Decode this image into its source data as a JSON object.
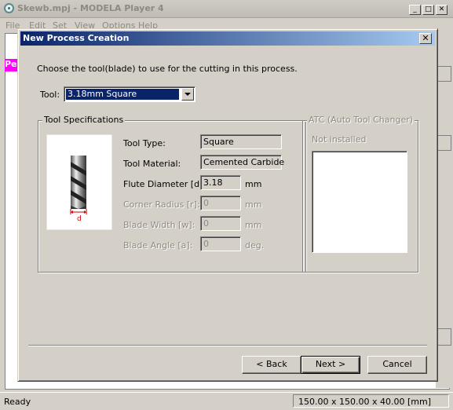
{
  "main_window": {
    "title": "Skewb.mpj - MODELA Player 4",
    "menu": [
      "File",
      "Edit",
      "Set",
      "View",
      "Options",
      "Help"
    ],
    "pink_label": "Pe",
    "status": "Ready",
    "dimensions": "150.00 x 150.00 x 40.00 [mm]"
  },
  "dialog": {
    "title": "New Process Creation",
    "instruction": "Choose the tool(blade) to use for the cutting in this process.",
    "tool_label": "Tool:",
    "tool_selected": "3.18mm Square",
    "specs": {
      "group_title": "Tool Specifications",
      "diagram_label": "d",
      "tool_type_label": "Tool Type:",
      "tool_type": "Square",
      "tool_material_label": "Tool Material:",
      "tool_material": "Cemented Carbide",
      "flute_diameter_label": "Flute Diameter [d]:",
      "flute_diameter": "3.18",
      "corner_radius_label": "Corner Radius [r]:",
      "corner_radius": "0",
      "blade_width_label": "Blade Width [w]:",
      "blade_width": "0",
      "blade_angle_label": "Blade Angle [a]:",
      "blade_angle": "0",
      "unit_mm": "mm",
      "unit_deg": "deg."
    },
    "atc": {
      "group_title": "ATC (Auto Tool Changer)",
      "status": "Not installed"
    },
    "buttons": {
      "back": "< Back",
      "next": "Next >",
      "cancel": "Cancel"
    }
  }
}
